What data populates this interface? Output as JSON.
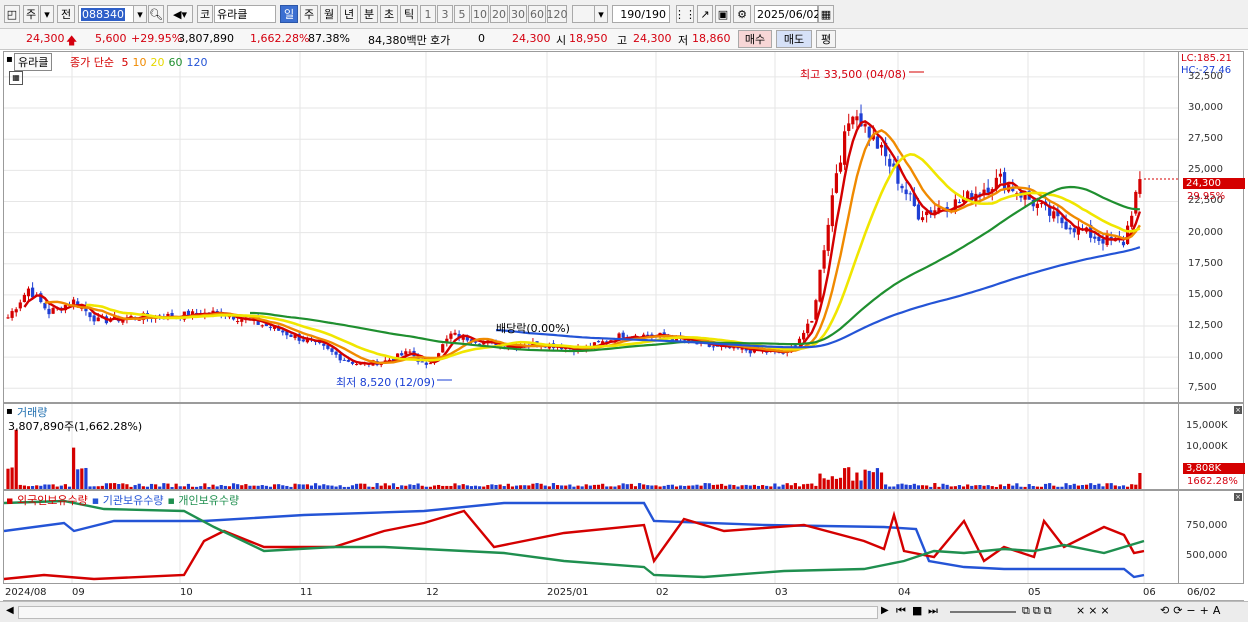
{
  "toolbar": {
    "market_label": "주",
    "prev_label": "전",
    "code": "088340",
    "market2_label": "코",
    "stock_name": "유라클",
    "periods": [
      "일",
      "주",
      "월",
      "년",
      "분",
      "초",
      "틱"
    ],
    "selected_period": "일",
    "minutes": [
      "1",
      "3",
      "5",
      "10",
      "20",
      "30",
      "60",
      "120"
    ],
    "count_value": "190",
    "count_total": "/190",
    "date": "2025/06/02"
  },
  "quote": {
    "price": "24,300",
    "change": "5,600",
    "change_pct": "+29.95%",
    "volume": "3,807,890",
    "volume_pct": "1,662.28%",
    "turnover_rate": "87.38%",
    "amount": "84,380백만",
    "hoga_label": "호가",
    "hoga_value": "0",
    "hoga_price": "24,300",
    "open_label": "시",
    "open": "18,950",
    "high_label": "고",
    "high": "24,300",
    "low_label": "저",
    "low": "18,860",
    "buy_label": "매수",
    "sell_label": "매도",
    "eval_label": "평"
  },
  "price_panel": {
    "name": "유라클",
    "ma_label": "종가 단순",
    "ma_periods": [
      {
        "label": "5",
        "color": "#d40000"
      },
      {
        "label": "10",
        "color": "#f08a00"
      },
      {
        "label": "20",
        "color": "#e6d800"
      },
      {
        "label": "60",
        "color": "#1f8f2f"
      },
      {
        "label": "120",
        "color": "#2454d6"
      }
    ],
    "lc": "LC:185.21",
    "hc": "HC:-27.46",
    "y_ticks": [
      "32,500",
      "30,000",
      "27,500",
      "25,000",
      "22,500",
      "20,000",
      "17,500",
      "15,000",
      "12,500",
      "10,000",
      "7,500"
    ],
    "y_values": [
      32500,
      30000,
      27500,
      25000,
      22500,
      20000,
      17500,
      15000,
      12500,
      10000,
      7500
    ],
    "price_tag": "24,300",
    "price_tag_pct": "29.95%",
    "high_annot": "최고 33,500 (04/08)",
    "low_annot": "최저 8,520 (12/09)",
    "dividend_annot": "배당락(0.00%)"
  },
  "volume_panel": {
    "title": "거래량",
    "info": "3,807,890주(1,662.28%)",
    "y_ticks": [
      "15,000K",
      "10,000K"
    ],
    "tag": "3,808K",
    "tag_pct": "1662.28%"
  },
  "holder_panel": {
    "legend": [
      {
        "label": "외국인보유수량",
        "color": "#d40000"
      },
      {
        "label": "기관보유수량",
        "color": "#2454d6"
      },
      {
        "label": "개인보유수량",
        "color": "#1f8f4f"
      }
    ],
    "y_ticks": [
      "750,000",
      "500,000"
    ]
  },
  "x_axis": {
    "labels": [
      "2024/08",
      "09",
      "10",
      "11",
      "12",
      "2025/01",
      "02",
      "03",
      "04",
      "05",
      "06",
      "06/02"
    ]
  },
  "colors": {
    "up": "#d40000",
    "down": "#1f3fd4",
    "ma5": "#d40000",
    "ma10": "#f08a00",
    "ma20": "#f0e600",
    "ma60": "#1f8f2f",
    "ma120": "#2454d6"
  }
}
